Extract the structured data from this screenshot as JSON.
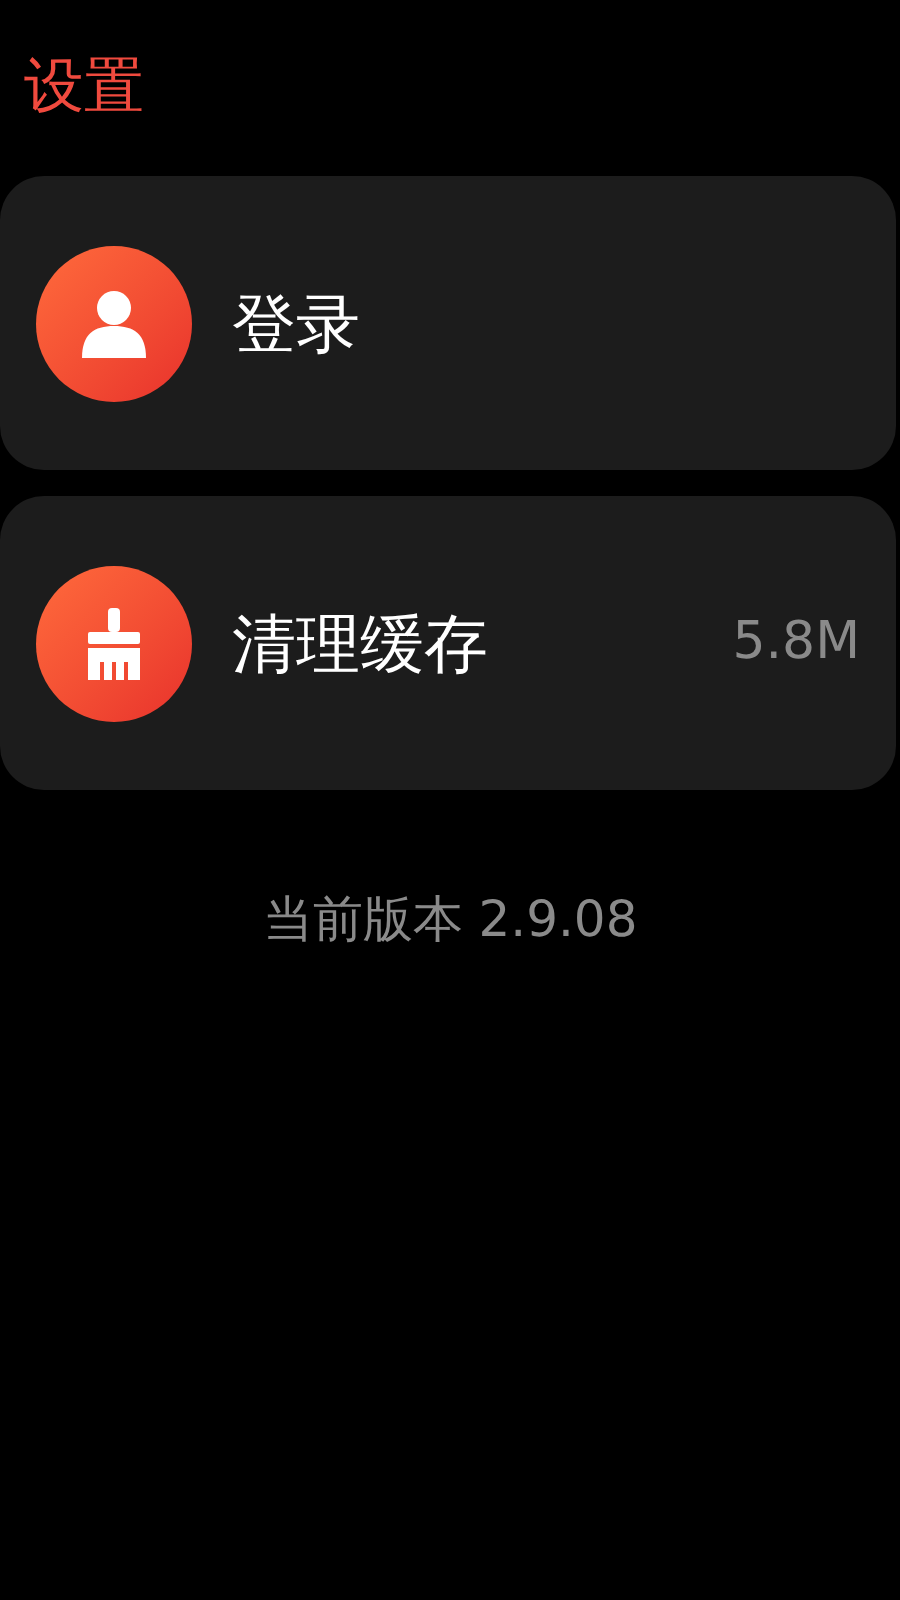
{
  "title": "设置",
  "items": [
    {
      "kind": "account",
      "label": "登录"
    },
    {
      "kind": "cache",
      "label": "清理缓存",
      "value": "5.8M"
    }
  ],
  "version": "当前版本 2.9.08"
}
